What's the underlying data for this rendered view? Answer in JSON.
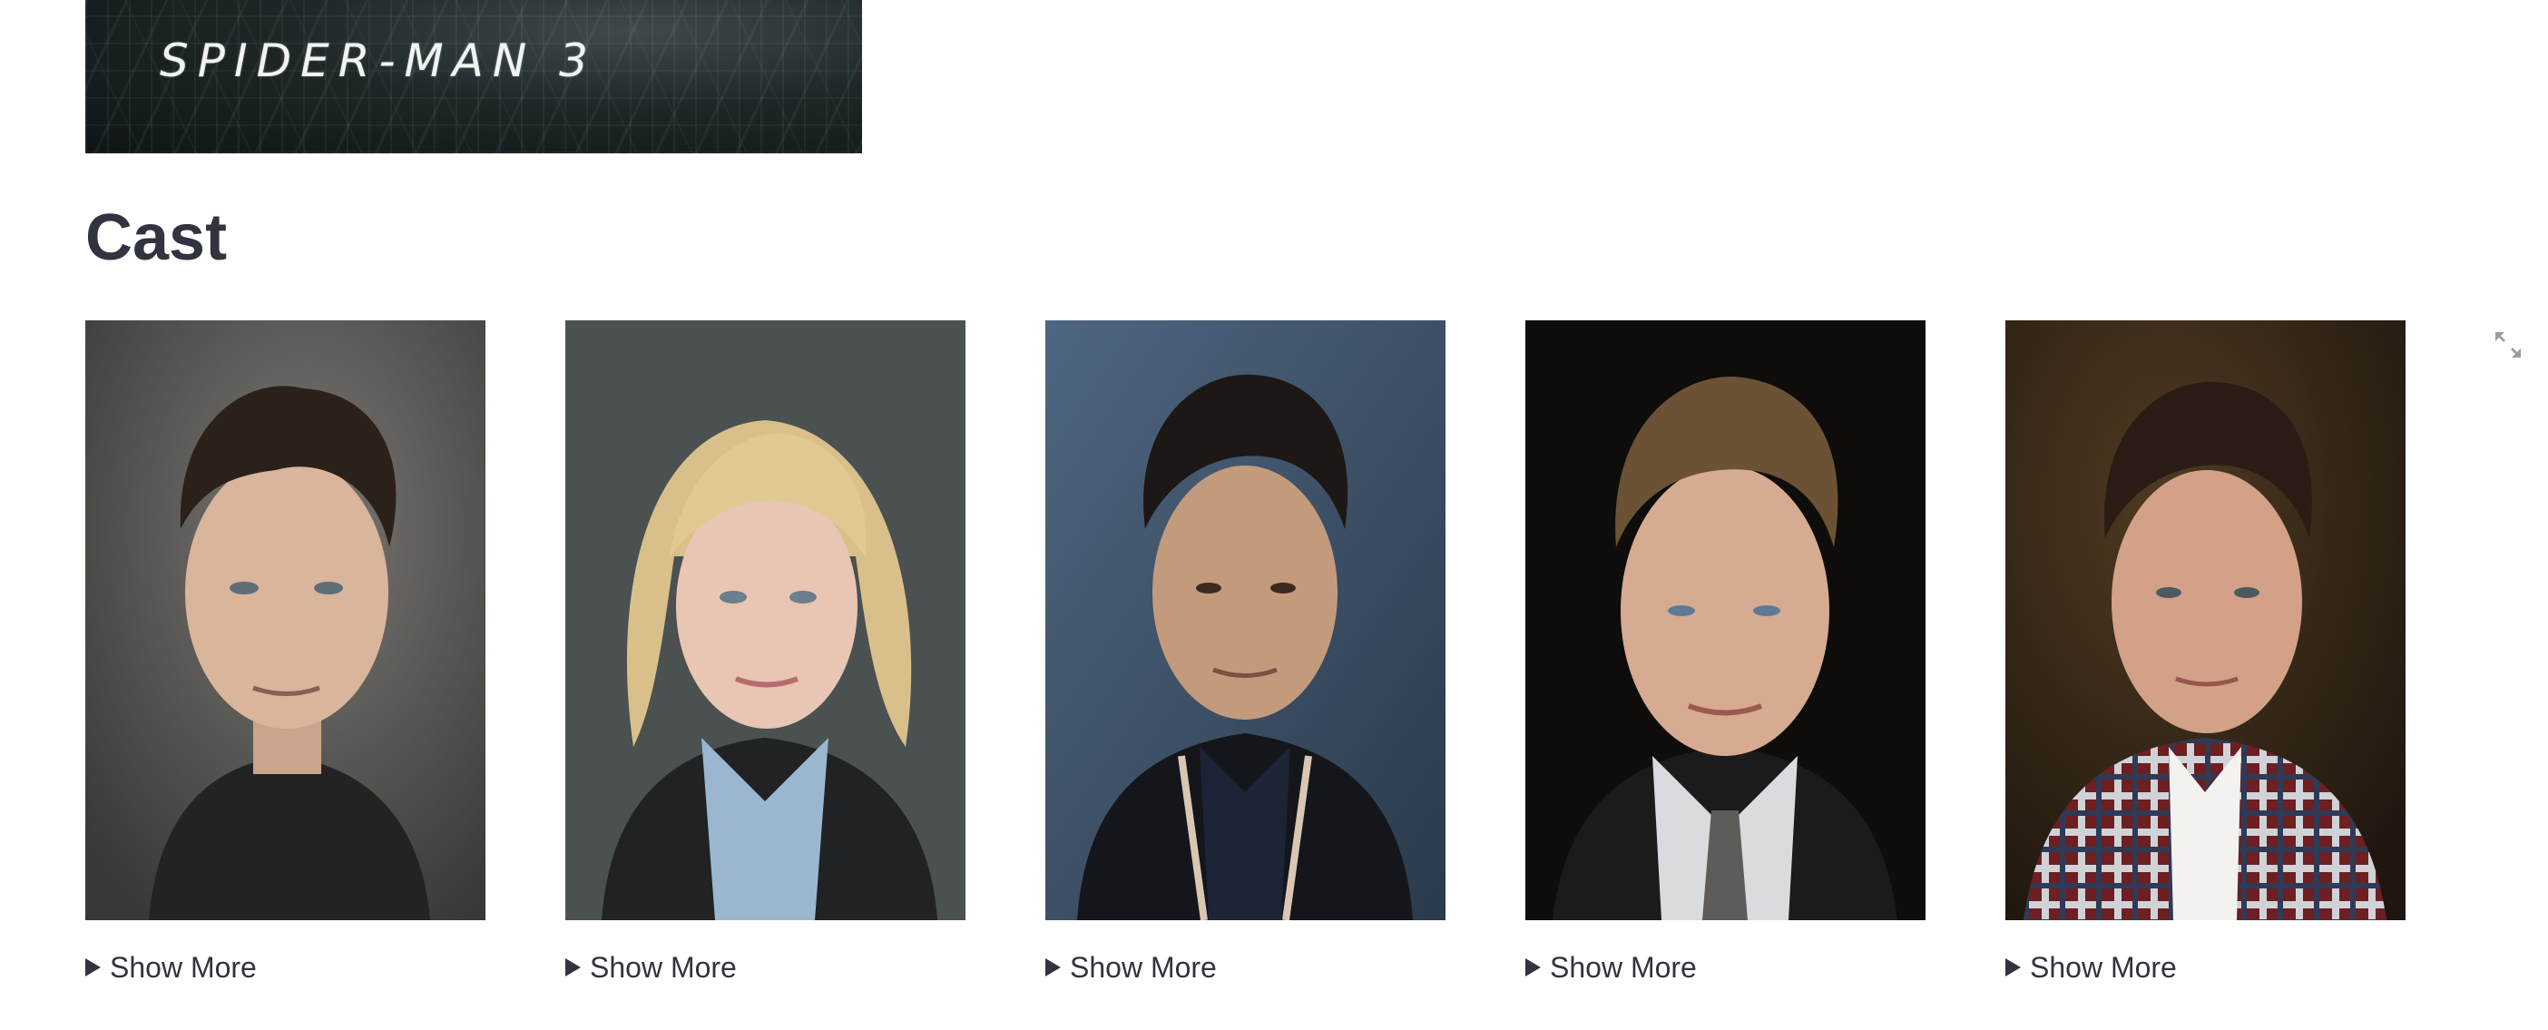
{
  "banner": {
    "title": "SPIDER-MAN 3"
  },
  "section": {
    "title": "Cast"
  },
  "icons": {
    "expand": "expand-arrows-icon"
  },
  "cast": [
    {
      "expander_label": "Show More"
    },
    {
      "expander_label": "Show More"
    },
    {
      "expander_label": "Show More"
    },
    {
      "expander_label": "Show More"
    },
    {
      "expander_label": "Show More"
    }
  ],
  "colors": {
    "text": "#31333f",
    "background": "#ffffff"
  }
}
